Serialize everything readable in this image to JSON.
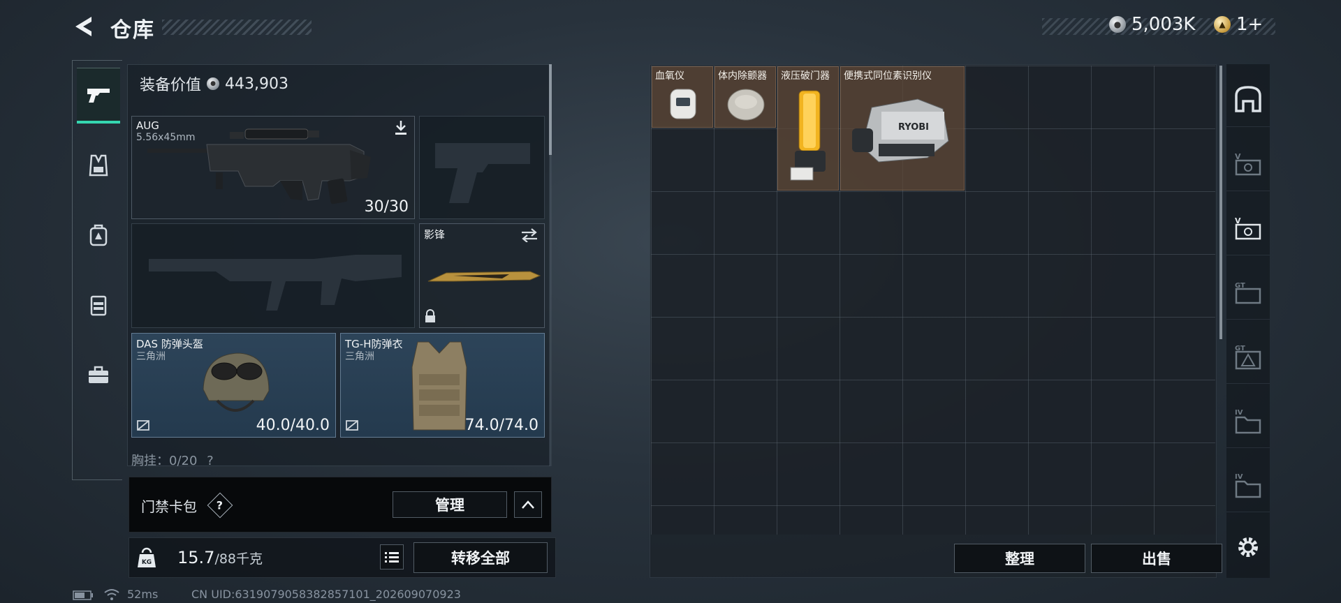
{
  "header": {
    "title": "仓库",
    "currency_silver": "5,003K",
    "currency_gold": "1+"
  },
  "nav": {
    "items": [
      "firearms",
      "armor",
      "backpack",
      "chest-rig",
      "toolbox"
    ],
    "active": "firearms"
  },
  "equipment": {
    "value_label": "装备价值",
    "value": "443,903",
    "primary_weapon": {
      "name": "AUG",
      "caliber": "5.56x45mm",
      "ammo": "30/30"
    },
    "secondary_weapon_empty": true,
    "primary2_empty": true,
    "melee": {
      "name": "影锋"
    },
    "helmet": {
      "name": "DAS 防弹头盔",
      "brand": "三角洲",
      "durability": "40.0/40.0"
    },
    "armor": {
      "name": "TG-H防弹衣",
      "brand": "三角洲",
      "durability": "74.0/74.0"
    },
    "chest_rig": {
      "label": "胸挂：0/20",
      "help": "?"
    }
  },
  "keycard": {
    "title": "门禁卡包",
    "help": "?",
    "manage_label": "管理"
  },
  "weight": {
    "current": "15.7",
    "max": "/88千克",
    "transfer_all_label": "转移全部"
  },
  "status": {
    "ping": "52ms",
    "uid": "CN UID:6319079058382857101_202609070923"
  },
  "storage": {
    "items": [
      {
        "name": "血氧仪"
      },
      {
        "name": "体内除颤器"
      },
      {
        "name": "液压破门器"
      },
      {
        "name": "便携式同位素识别仪",
        "brand_text": "RYOBI"
      }
    ],
    "sort_label": "整理",
    "sell_label": "出售"
  },
  "tools": {
    "items": [
      "safe",
      "case-v-1",
      "case-v-2",
      "case-gt-1",
      "case-gt-2",
      "folder-iv-1",
      "folder-iv-2",
      "settings"
    ]
  },
  "colors": {
    "accent": "#35d6b0",
    "item_bg": "#5f4837",
    "slot_blue": "#2d4459"
  }
}
